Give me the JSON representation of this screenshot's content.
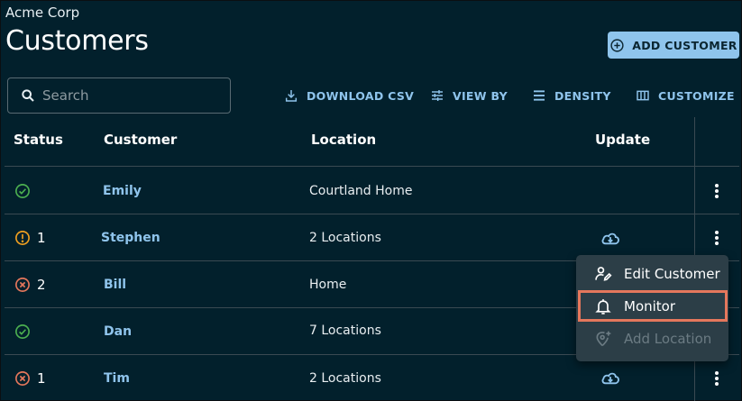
{
  "org_name": "Acme Corp",
  "page_title": "Customers",
  "add_button_label": "ADD CUSTOMER",
  "search": {
    "placeholder": "Search",
    "value": ""
  },
  "toolbar": {
    "download": "DOWNLOAD CSV",
    "view_by": "VIEW BY",
    "density": "DENSITY",
    "customize": "CUSTOMIZE"
  },
  "columns": {
    "status": "Status",
    "customer": "Customer",
    "location": "Location",
    "update": "Update"
  },
  "rows": [
    {
      "status": "ok",
      "count": "",
      "customer": "Emily",
      "location": "Courtland Home",
      "update_available": false
    },
    {
      "status": "warning",
      "count": "1",
      "customer": "Stephen",
      "location": "2 Locations",
      "update_available": true
    },
    {
      "status": "error",
      "count": "2",
      "customer": "Bill",
      "location": "Home",
      "update_available": false
    },
    {
      "status": "ok",
      "count": "",
      "customer": "Dan",
      "location": "7 Locations",
      "update_available": false
    },
    {
      "status": "error",
      "count": "1",
      "customer": "Tim",
      "location": "2 Locations",
      "update_available": true
    }
  ],
  "context_menu": {
    "edit": "Edit Customer",
    "monitor": "Monitor",
    "add_location": "Add Location"
  },
  "colors": {
    "background": "#02202c",
    "accent": "#8fc4ec",
    "ok": "#4caf50",
    "warning": "#f0a020",
    "error": "#e5775c",
    "highlight": "#e5775c"
  }
}
